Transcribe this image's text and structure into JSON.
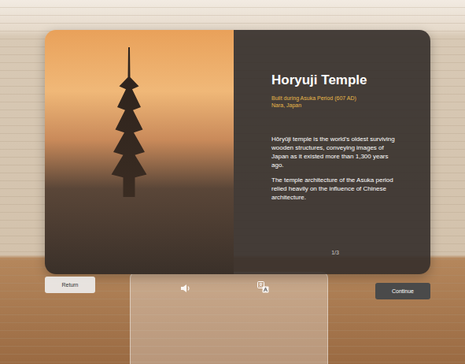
{
  "panel": {
    "title": "Horyuji Temple",
    "subtitle": "Built during Asuka Period (607 AD)",
    "location": "Nara, Japan",
    "paragraphs": [
      "Hōryūji temple is the world's oldest surviving wooden structures, conveying images of Japan as it existed more than 1,300 years ago.",
      "The temple architecture of the Asuka period relied heavily on the influence of Chinese architecture."
    ],
    "page": "1/3"
  },
  "controls": {
    "back_button": "Return",
    "continue_button": "Continue"
  }
}
